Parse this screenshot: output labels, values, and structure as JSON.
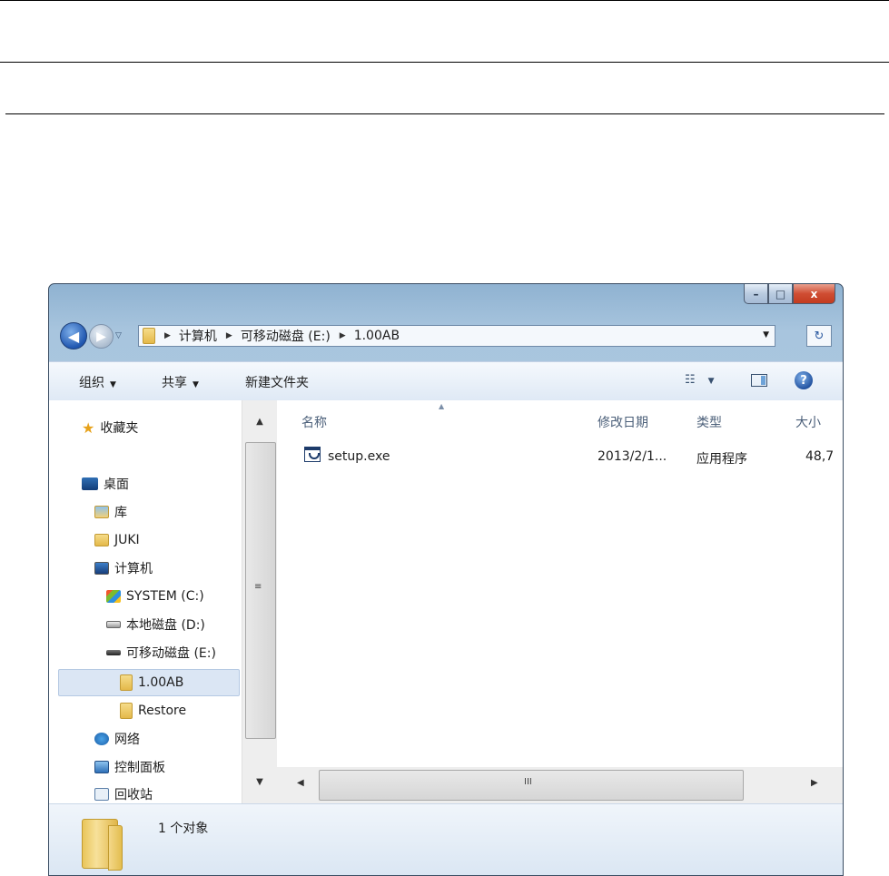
{
  "window": {
    "caption_buttons": {
      "minimize": "–",
      "maximize": "□",
      "close": "x"
    }
  },
  "address_bar": {
    "crumbs": [
      "计算机",
      "可移动磁盘 (E:)",
      "1.00AB"
    ]
  },
  "toolbar": {
    "organize": "组织",
    "share": "共享",
    "new_folder": "新建文件夹"
  },
  "nav_pane": {
    "favorites": "收藏夹",
    "desktop": "桌面",
    "libraries": "库",
    "user": "JUKI",
    "computer": "计算机",
    "drive_c": "SYSTEM (C:)",
    "drive_d": "本地磁盘 (D:)",
    "drive_e": "可移动磁盘 (E:)",
    "folder_selected": "1.00AB",
    "folder_restore": "Restore",
    "network": "网络",
    "control_panel": "控制面板",
    "recycle_bin": "回收站"
  },
  "columns": {
    "name": "名称",
    "date_modified": "修改日期",
    "type": "类型",
    "size": "大小"
  },
  "files": [
    {
      "name": "setup.exe",
      "date": "2013/2/1...",
      "type": "应用程序",
      "size": "48,7"
    }
  ],
  "details_pane": {
    "count": "1 个对象"
  },
  "scrollbar": {
    "v_grip": "≡",
    "h_grip": "III"
  },
  "colors": {
    "selection": "#dbe6f4",
    "frame": "#a8c5de",
    "close_button": "#cf4d33"
  }
}
